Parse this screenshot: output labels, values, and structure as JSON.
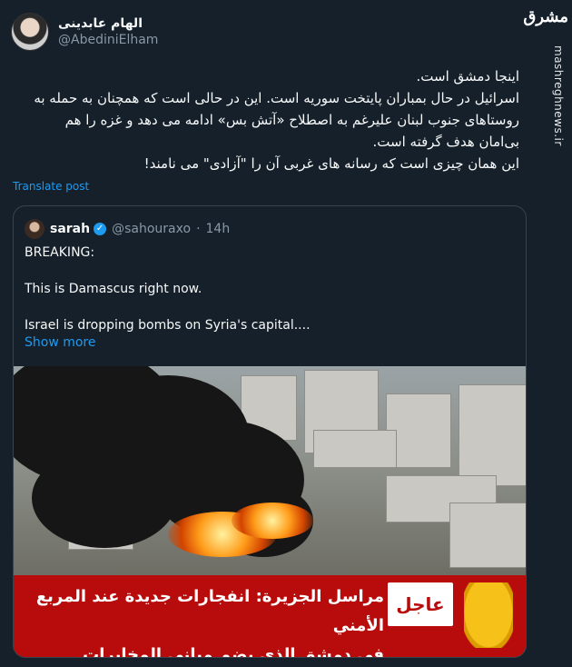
{
  "author": {
    "display_name": "الهام عابدینی",
    "handle": "@AbediniElham"
  },
  "watermark": {
    "logo": "مشرق",
    "vertical_text": "mashreghnews.ir"
  },
  "tweet": {
    "lines": [
      "اینجا دمشق است.",
      "اسرائیل در حال بمباران پایتخت سوریه است. این در حالی است که همچنان به حمله به",
      "روستاهای جنوب لبنان علیرغم به اصطلاح «آتش بس» ادامه می دهد و غزه را هم",
      "بی‌امان هدف گرفته است.",
      "این  همان چیزی است که رسانه های غربی آن را \"آزادی\" می نامند!"
    ],
    "translate_label": "Translate post"
  },
  "quote": {
    "name": "sarah",
    "handle": "@sahouraxo",
    "separator": "·",
    "time": "14h",
    "text_lines": [
      "BREAKING:",
      "This is Damascus right now.",
      "Israel is dropping bombs on Syria's capital...."
    ],
    "show_more": "Show more"
  },
  "media": {
    "banner_lines": [
      "مراسل الجزيرة: انفجارات جديدة عند المربع الأمني",
      "في دمشق الذي يضم مباني المخابرات والجمارك"
    ],
    "urgent_label": "عاجل",
    "channel_logo": "aljazeera-logo"
  },
  "colors": {
    "background": "#15202b",
    "link": "#1d9bf0",
    "banner": "#b80c0c"
  }
}
